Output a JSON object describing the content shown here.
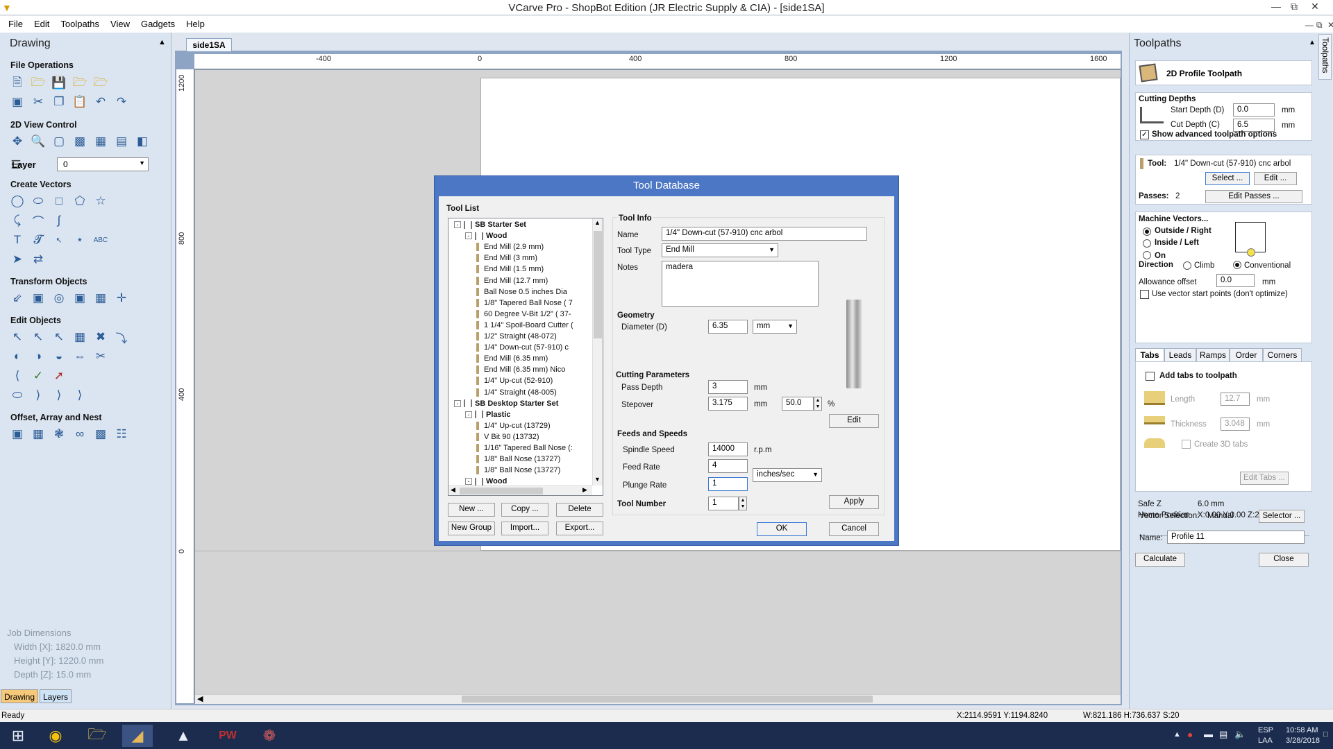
{
  "window": {
    "title": "VCarve Pro - ShopBot Edition (JR Electric Supply & CIA) - [side1SA]"
  },
  "menu": [
    "File",
    "Edit",
    "Toolpaths",
    "View",
    "Gadgets",
    "Help"
  ],
  "left_panel": {
    "title": "Drawing",
    "sections": {
      "file_ops": "File Operations",
      "view_control": "2D View Control",
      "create_vectors": "Create Vectors",
      "transform": "Transform Objects",
      "edit_objects": "Edit Objects",
      "offset": "Offset, Array and Nest"
    },
    "layer_label": "Layer",
    "layer_value": "0",
    "job_dimensions": {
      "title": "Job Dimensions",
      "width": "Width  [X]: 1820.0 mm",
      "height": "Height [Y]: 1220.0 mm",
      "depth": "Depth  [Z]: 15.0 mm"
    },
    "tabs": [
      "Drawing",
      "Layers"
    ]
  },
  "document": {
    "tab": "side1SA",
    "ruler_top": [
      "-400",
      "0",
      "400",
      "800",
      "1200",
      "1600"
    ],
    "ruler_left": [
      "1200",
      "800",
      "400",
      "0"
    ]
  },
  "dialog": {
    "title": "Tool Database",
    "tool_list_label": "Tool List",
    "tree": [
      {
        "text": "SB Starter Set",
        "level": 0,
        "bold": true
      },
      {
        "text": "Wood",
        "level": 1,
        "bold": true
      },
      {
        "text": "End Mill (2.9 mm)",
        "level": 2
      },
      {
        "text": "End Mill (3 mm)",
        "level": 2
      },
      {
        "text": "End Mill (1.5 mm)",
        "level": 2
      },
      {
        "text": "End Mill (12.7 mm)",
        "level": 2
      },
      {
        "text": "Ball Nose 0.5 inches Dia",
        "level": 2
      },
      {
        "text": "1/8\" Tapered Ball Nose ( 7",
        "level": 2
      },
      {
        "text": "60 Degree V-Bit 1/2\" ( 37-",
        "level": 2
      },
      {
        "text": "1 1/4\" Spoil-Board Cutter (",
        "level": 2
      },
      {
        "text": "1/2\" Straight  (48-072)",
        "level": 2
      },
      {
        "text": "1/4\"  Down-cut (57-910) c",
        "level": 2,
        "selected": true
      },
      {
        "text": "End Mill (6.35 mm)",
        "level": 2
      },
      {
        "text": "End Mill (6.35 mm) Nico",
        "level": 2
      },
      {
        "text": "1/4\" Up-cut (52-910)",
        "level": 2
      },
      {
        "text": "1/4\" Straight (48-005)",
        "level": 2
      },
      {
        "text": "SB Desktop Starter Set",
        "level": 0,
        "bold": true
      },
      {
        "text": "Plastic",
        "level": 1,
        "bold": true
      },
      {
        "text": "1/4\" Up-cut (13729)",
        "level": 2
      },
      {
        "text": "V Bit 90 (13732)",
        "level": 2
      },
      {
        "text": "1/16\" Tapered Ball Nose (:",
        "level": 2
      },
      {
        "text": "1/8\" Ball Nose (13727)",
        "level": 2
      },
      {
        "text": "1/8\" Ball Nose (13727)",
        "level": 2
      },
      {
        "text": "Wood",
        "level": 1,
        "bold": true
      }
    ],
    "tree_buttons": {
      "new": "New ...",
      "copy": "Copy ...",
      "delete": "Delete",
      "new_group": "New Group",
      "import": "Import...",
      "export": "Export..."
    },
    "tool_info": {
      "header": "Tool Info",
      "name_label": "Name",
      "name_value": "1/4\"  Down-cut (57-910) cnc arbol",
      "type_label": "Tool Type",
      "type_value": "End Mill",
      "notes_label": "Notes",
      "notes_value": "madera"
    },
    "geometry": {
      "header": "Geometry",
      "diameter_label": "Diameter (D)",
      "diameter_value": "6.35",
      "unit": "mm"
    },
    "cutting": {
      "header": "Cutting Parameters",
      "pass_depth_label": "Pass Depth",
      "pass_depth_value": "3",
      "pass_depth_unit": "mm",
      "stepover_label": "Stepover",
      "stepover_value": "3.175",
      "stepover_unit": "mm",
      "stepover_pct": "50.0",
      "pct": "%",
      "edit": "Edit"
    },
    "feeds": {
      "header": "Feeds and Speeds",
      "spindle_label": "Spindle Speed",
      "spindle_value": "14000",
      "spindle_unit": "r.p.m",
      "feed_label": "Feed Rate",
      "feed_value": "4",
      "plunge_label": "Plunge Rate",
      "plunge_value": "1",
      "rate_unit": "inches/sec"
    },
    "tool_number_label": "Tool Number",
    "tool_number_value": "1",
    "apply": "Apply",
    "ok": "OK",
    "cancel": "Cancel"
  },
  "right_panel": {
    "title": "Toolpaths",
    "vertical_tab": "Toolpaths",
    "toolpath_name": "2D Profile Toolpath",
    "cutting_depths": {
      "header": "Cutting Depths",
      "start_label": "Start Depth (D)",
      "start_value": "0.0",
      "cut_label": "Cut Depth (C)",
      "cut_value": "6.5",
      "unit": "mm"
    },
    "advanced_label": "Show advanced toolpath options",
    "tool_label": "Tool:",
    "tool_value": "1/4\"  Down-cut (57-910) cnc arbol",
    "select": "Select ...",
    "edit": "Edit ...",
    "passes_label": "Passes:",
    "passes_value": "2",
    "edit_passes": "Edit Passes ...",
    "machine_vectors": "Machine Vectors...",
    "outside": "Outside / Right",
    "inside": "Inside / Left",
    "on": "On",
    "direction": "Direction",
    "climb": "Climb",
    "conventional": "Conventional",
    "allowance_label": "Allowance offset",
    "allowance_value": "0.0",
    "allowance_unit": "mm",
    "vector_start": "Use vector start points (don't optimize)",
    "tabs": [
      "Tabs",
      "Leads",
      "Ramps",
      "Order",
      "Corners"
    ],
    "add_tabs": "Add tabs to toolpath",
    "length_label": "Length",
    "length_value": "12.7",
    "thickness_label": "Thickness",
    "thickness_value": "3.048",
    "tab_unit": "mm",
    "create_3d": "Create 3D tabs",
    "edit_tabs": "Edit Tabs ...",
    "safe_z_label": "Safe Z",
    "safe_z_value": "6.0 mm",
    "home_label": "Home Position",
    "home_value": "X:0.00 Y:0.00 Z:20.00",
    "vector_selection_label": "Vector Selection:",
    "vector_selection_value": "Manual",
    "selector": "Selector ...",
    "name_label": "Name:",
    "name_value": "Profile 11",
    "calculate": "Calculate",
    "close": "Close"
  },
  "status": {
    "ready": "Ready",
    "coords": "X:2114.9591 Y:1194.8240",
    "size": "W:821.186   H:736.637  S:20"
  },
  "taskbar": {
    "lang": "ESP",
    "lang2": "LAA",
    "time": "10:58 AM",
    "date": "3/28/2018"
  }
}
